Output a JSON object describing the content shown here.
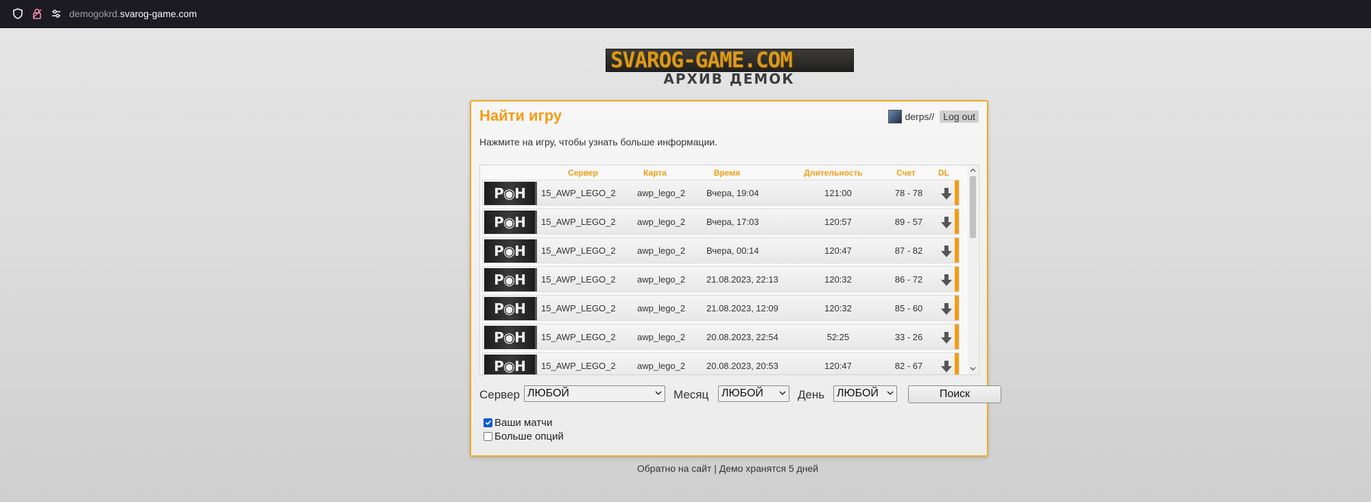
{
  "browser": {
    "url_prefix": "demogokrd.",
    "url_domain": "svarog-game.com"
  },
  "logo": {
    "text": "SVAROG-GAME.COM",
    "subtitle": "АРХИВ ДЕМОК"
  },
  "panel": {
    "title": "Найти игру",
    "username": "derps//",
    "logout_label": "Log out",
    "hint": "Нажмите на игру, чтобы узнать больше информации."
  },
  "table": {
    "headers": {
      "server": "Сервер",
      "map": "Карта",
      "time": "Время",
      "duration": "Длительность",
      "score": "Счет",
      "dl": "DL"
    },
    "rows": [
      {
        "thumb": "P◉H",
        "server": "15_AWP_LEGO_2",
        "map": "awp_lego_2",
        "time": "Вчера, 19:04",
        "duration": "121:00",
        "score": "78 - 78"
      },
      {
        "thumb": "P◉H",
        "server": "15_AWP_LEGO_2",
        "map": "awp_lego_2",
        "time": "Вчера, 17:03",
        "duration": "120:57",
        "score": "89 - 57"
      },
      {
        "thumb": "P◉H",
        "server": "15_AWP_LEGO_2",
        "map": "awp_lego_2",
        "time": "Вчера, 00:14",
        "duration": "120:47",
        "score": "87 - 82"
      },
      {
        "thumb": "P◉H",
        "server": "15_AWP_LEGO_2",
        "map": "awp_lego_2",
        "time": "21.08.2023, 22:13",
        "duration": "120:32",
        "score": "86 - 72"
      },
      {
        "thumb": "P◉H",
        "server": "15_AWP_LEGO_2",
        "map": "awp_lego_2",
        "time": "21.08.2023, 12:09",
        "duration": "120:32",
        "score": "85 - 60"
      },
      {
        "thumb": "P◉H",
        "server": "15_AWP_LEGO_2",
        "map": "awp_lego_2",
        "time": "20.08.2023, 22:54",
        "duration": "52:25",
        "score": "33 - 26"
      },
      {
        "thumb": "P◉H",
        "server": "15_AWP_LEGO_2",
        "map": "awp_lego_2",
        "time": "20.08.2023, 20:53",
        "duration": "120:47",
        "score": "82 - 67"
      }
    ]
  },
  "filters": {
    "server_label": "Сервер",
    "server_value": "ЛЮБОЙ",
    "month_label": "Месяц",
    "month_value": "ЛЮБОЙ",
    "day_label": "День",
    "day_value": "ЛЮБОЙ",
    "search_label": "Поиск",
    "my_matches_label": "Ваши матчи",
    "my_matches_checked": true,
    "more_options_label": "Больше опций",
    "more_options_checked": false
  },
  "footer": {
    "back_link": "Обратно на сайт",
    "separator": "|",
    "retention": "Демо хранятся 5 дней"
  },
  "colors": {
    "accent": "#f39c12",
    "browser_bar": "#1c1b22"
  }
}
